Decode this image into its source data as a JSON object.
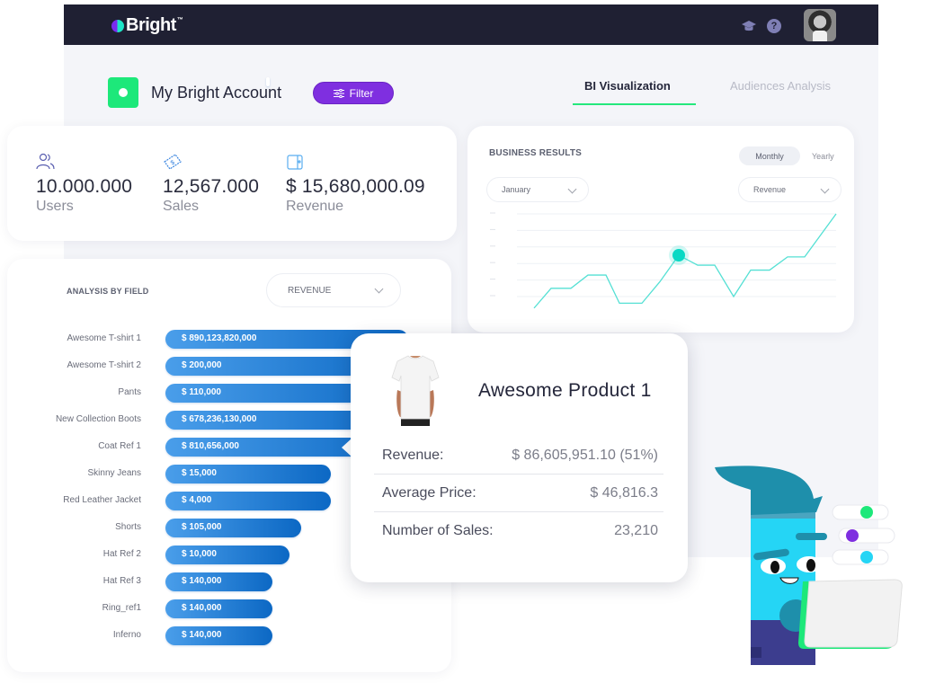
{
  "app": {
    "brand": "Bright",
    "account_title": "My Bright Account",
    "filter_label": "Filter",
    "topbar_icons": [
      "graduation-cap-icon",
      "help-icon"
    ],
    "tabs": [
      {
        "label": "BI Visualization",
        "active": true
      },
      {
        "label": "Audiences Analysis",
        "active": false
      }
    ]
  },
  "stats": [
    {
      "icon": "users-icon",
      "value": "10.000.000",
      "label": "Users"
    },
    {
      "icon": "dollar-ticket-icon",
      "value": "12,567.000",
      "label": "Sales"
    },
    {
      "icon": "wallet-icon",
      "value": "$ 15,680,000.09",
      "label": "Revenue"
    }
  ],
  "business_results": {
    "title": "BUSINESS RESULTS",
    "period_toggle": {
      "options": [
        "Monthly",
        "Yearly"
      ],
      "selected": "Monthly"
    },
    "month_select": "January",
    "metric_select": "Revenue"
  },
  "analysis": {
    "title": "ANALYSIS BY FIELD",
    "field_select": "REVENUE"
  },
  "tooltip": {
    "product_name": "Awesome Product 1",
    "rows": [
      {
        "label": "Revenue:",
        "value": "$ 86,605,951.10 (51%)"
      },
      {
        "label": "Average Price:",
        "value": "$ 46,816.3"
      },
      {
        "label": "Number of Sales:",
        "value": "23,210"
      }
    ]
  },
  "colors": {
    "topbar": "#1f2033",
    "accent_green": "#25e87d",
    "accent_purple": "#7f2fe0",
    "bar_blue": "#1a78d6",
    "line_teal": "#55e0d4",
    "highlight_point": "#08d9c4"
  },
  "chart_data": [
    {
      "type": "line",
      "title": "BUSINESS RESULTS",
      "xlabel": "",
      "ylabel": "",
      "grid": true,
      "y_tick_labels": [
        "",
        "",
        "",
        "",
        "",
        ""
      ],
      "ylim": [
        0,
        6
      ],
      "x": [
        0,
        1,
        2,
        3,
        4,
        5,
        6,
        7,
        8,
        9,
        10,
        11,
        12,
        13,
        14,
        15,
        16
      ],
      "values": [
        0.3,
        1.5,
        1.5,
        2.3,
        2.3,
        0.6,
        0.6,
        1.9,
        3.5,
        2.9,
        2.9,
        1.0,
        2.6,
        2.6,
        3.4,
        3.4,
        6.0
      ],
      "highlight_index": 8,
      "series_color": "#55e0d4"
    },
    {
      "type": "bar",
      "orientation": "horizontal",
      "title": "ANALYSIS BY FIELD",
      "categories": [
        "Awesome T-shirt 1",
        "Awesome T-shirt 2",
        "Pants",
        "New Collection Boots",
        "Coat Ref 1",
        "Skinny Jeans",
        "Red Leather Jacket",
        "Shorts",
        "Hat Ref 2",
        "Hat Ref 3",
        "Ring_ref1",
        "Inferno"
      ],
      "value_labels": [
        "$ 890,123,820,000",
        "$ 200,000",
        "$ 110,000",
        "$ 678,236,130,000",
        "$ 810,656,000",
        "$ 15,000",
        "$ 4,000",
        "$ 105,000",
        "$ 10,000",
        "$ 140,000",
        "$ 140,000",
        "$ 140,000"
      ],
      "bar_fraction": [
        1.0,
        1.0,
        1.0,
        1.0,
        1.0,
        0.68,
        0.68,
        0.56,
        0.51,
        0.44,
        0.44,
        0.44
      ]
    }
  ]
}
